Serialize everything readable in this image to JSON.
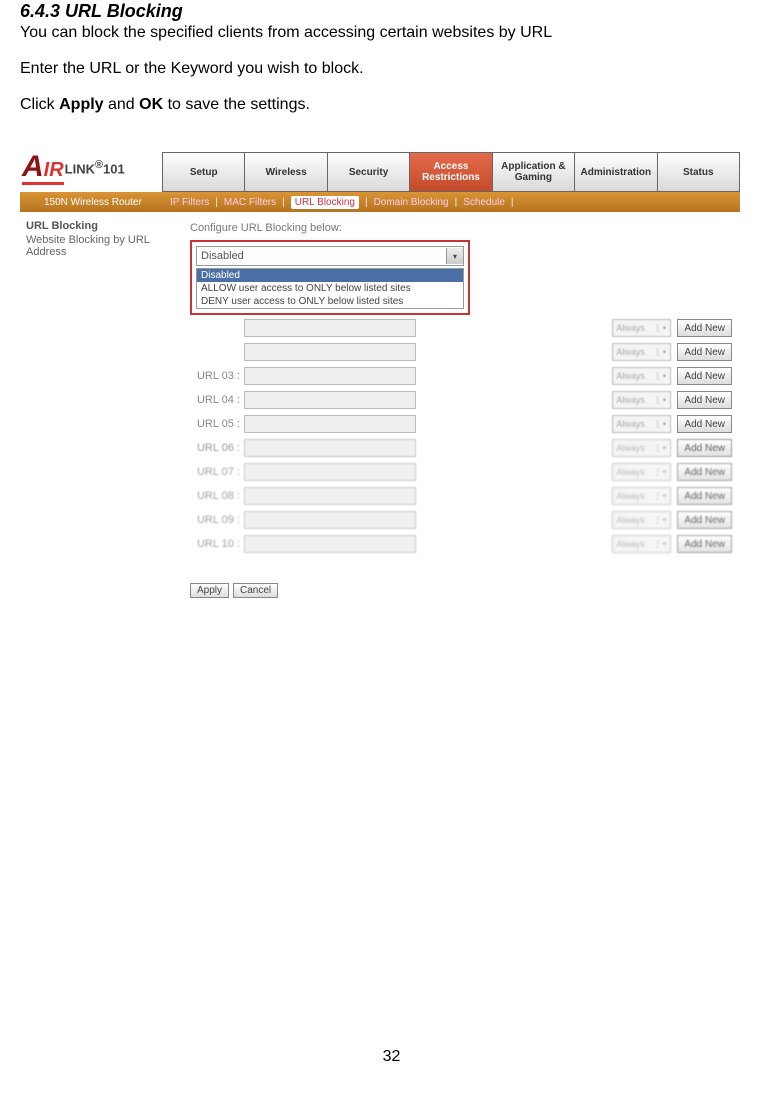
{
  "doc": {
    "heading": "6.4.3 URL Blocking",
    "para1": "You can block the specified clients from accessing certain websites by URL",
    "para2": "Enter the URL or the Keyword you wish to block.",
    "para3_pre": "Click ",
    "para3_b1": "Apply",
    "para3_mid": " and ",
    "para3_b2": "OK",
    "para3_post": " to save the settings.",
    "page_number": "32"
  },
  "ui": {
    "logo_brand": "AIRLINK",
    "logo_model": "101",
    "device_line": "150N Wireless Router",
    "tabs": [
      "Setup",
      "Wireless",
      "Security",
      "Access Restrictions",
      "Application & Gaming",
      "Administration",
      "Status"
    ],
    "subnav": [
      "IP Filters",
      "MAC Filters",
      "URL Blocking",
      "Domain Blocking",
      "Schedule"
    ],
    "sidebar_title": "URL Blocking",
    "sidebar_text": "Website Blocking by URL Address",
    "configure_label": "Configure URL Blocking below:",
    "dropdown_value": "Disabled",
    "dropdown_options": [
      "Disabled",
      "ALLOW user access to ONLY below listed sites",
      "DENY user access to ONLY below listed sites"
    ],
    "always_label": "Always",
    "addnew_label": "Add New",
    "url_labels": [
      "URL 03 :",
      "URL 04 :",
      "URL 05 :",
      "URL 06 :",
      "URL 07 :",
      "URL 08 :",
      "URL 09 :",
      "URL 10 :"
    ],
    "apply_btn": "Apply",
    "cancel_btn": "Cancel"
  }
}
